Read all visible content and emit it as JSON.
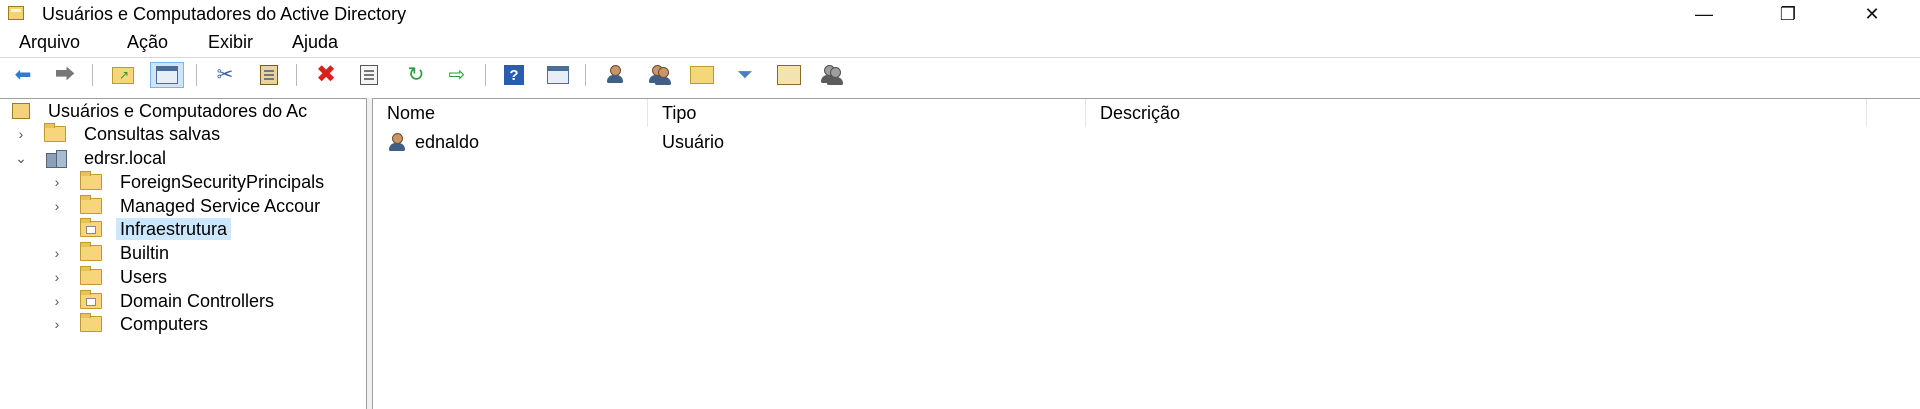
{
  "window": {
    "title": "Usuários e Computadores do Active Directory",
    "controls": {
      "minimize": "—",
      "maximize": "❐",
      "close": "✕"
    }
  },
  "menu": [
    "Arquivo",
    "Ação",
    "Exibir",
    "Ajuda"
  ],
  "toolbar": {
    "buttons": [
      "back-icon",
      "forward-icon",
      "up-folder-icon",
      "show-hide-console-tree-icon",
      "cut-icon",
      "paste-icon",
      "delete-icon",
      "properties-icon",
      "refresh-icon",
      "export-list-icon",
      "help-icon",
      "show-action-pane-icon",
      "new-user-icon",
      "new-group-icon",
      "new-ou-icon",
      "filter-icon",
      "find-icon",
      "add-to-group-icon"
    ]
  },
  "tree": {
    "root": "Usuários e Computadores do Ac",
    "saved_queries": "Consultas salvas",
    "domain": "edrsr.local",
    "children": [
      {
        "label": "ForeignSecurityPrincipals",
        "ou": false,
        "selected": false
      },
      {
        "label": "Managed Service Accour",
        "ou": false,
        "selected": false
      },
      {
        "label": "Infraestrutura",
        "ou": true,
        "selected": true
      },
      {
        "label": "Builtin",
        "ou": false,
        "selected": false
      },
      {
        "label": "Users",
        "ou": false,
        "selected": false
      },
      {
        "label": "Domain Controllers",
        "ou": true,
        "selected": false
      },
      {
        "label": "Computers",
        "ou": false,
        "selected": false
      }
    ]
  },
  "list": {
    "columns": [
      "Nome",
      "Tipo",
      "Descrição"
    ],
    "rows": [
      {
        "name": "ednaldo",
        "type": "Usuário",
        "description": ""
      }
    ]
  },
  "colors": {
    "selection": "#cce8ff",
    "folder": "#f6d67a",
    "delete": "#d9211c",
    "arrow": "#2e7bd6"
  }
}
